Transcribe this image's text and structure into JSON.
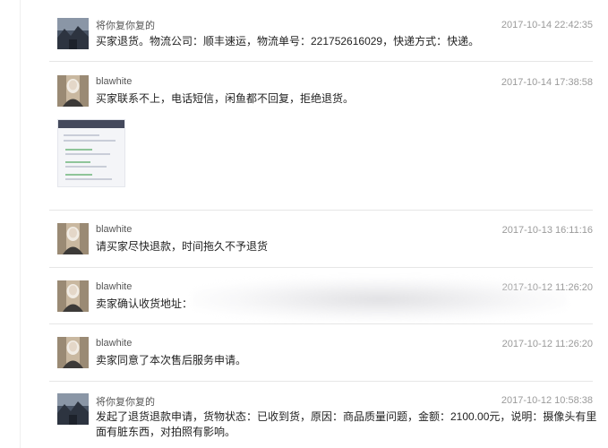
{
  "messages": [
    {
      "name": "将你复你复的",
      "time": "2017-10-14 22:42:35",
      "text": "买家退货。物流公司：顺丰速运，物流单号：221752616029，快递方式：快递。",
      "avatar": "landscape"
    },
    {
      "name": "blawhite",
      "time": "2017-10-14 17:38:58",
      "text": "买家联系不上，电话短信，闲鱼都不回复，拒绝退货。",
      "avatar": "portrait",
      "attachment": "screenshot-thumbnail"
    },
    {
      "name": "blawhite",
      "time": "2017-10-13 16:11:16",
      "text": "请买家尽快退款，时间拖久不予退货",
      "avatar": "portrait"
    },
    {
      "name": "blawhite",
      "time": "2017-10-12 11:26:20",
      "text": "卖家确认收货地址：",
      "avatar": "portrait",
      "redacted": true
    },
    {
      "name": "blawhite",
      "time": "2017-10-12 11:26:20",
      "text": "卖家同意了本次售后服务申请。",
      "avatar": "portrait"
    },
    {
      "name": "将你复你复的",
      "time": "2017-10-12 10:58:38",
      "text": "发起了退货退款申请，货物状态：已收到货，原因：商品质量问题，金额：2100.00元，说明：摄像头有里面有脏东西，对拍照有影响。",
      "avatar": "landscape"
    }
  ]
}
